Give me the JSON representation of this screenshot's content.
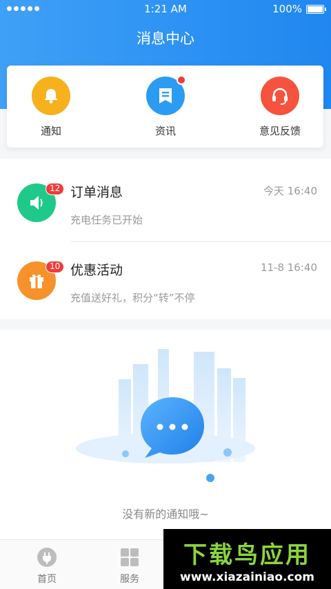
{
  "status_bar": {
    "time": "1:21 AM",
    "battery": "100%"
  },
  "header": {
    "title": "消息中心"
  },
  "quick_actions": [
    {
      "label": "通知",
      "icon": "bell-icon",
      "color": "#f7b11c"
    },
    {
      "label": "资讯",
      "icon": "news-icon",
      "color": "#2b9cf2",
      "has_dot": true
    },
    {
      "label": "意见反馈",
      "icon": "headset-icon",
      "color": "#f5533d"
    }
  ],
  "messages": [
    {
      "title": "订单消息",
      "subtitle": "充电任务已开始",
      "time": "今天 16:40",
      "badge": "12",
      "icon": "speaker-icon",
      "color": "#1fc98a"
    },
    {
      "title": "优惠活动",
      "subtitle": "充值送好礼，积分“转”不停",
      "time": "11-8 16:40",
      "badge": "10",
      "icon": "gift-icon",
      "color": "#f7922a"
    }
  ],
  "empty_state": {
    "text": "没有新的通知哦~"
  },
  "tabbar": {
    "items": [
      {
        "label": "首页",
        "icon": "plug-icon"
      },
      {
        "label": "服务",
        "icon": "grid-icon"
      }
    ]
  },
  "watermark": {
    "logo": "下载鸟应用",
    "url": "www.xiazainiao.com"
  }
}
